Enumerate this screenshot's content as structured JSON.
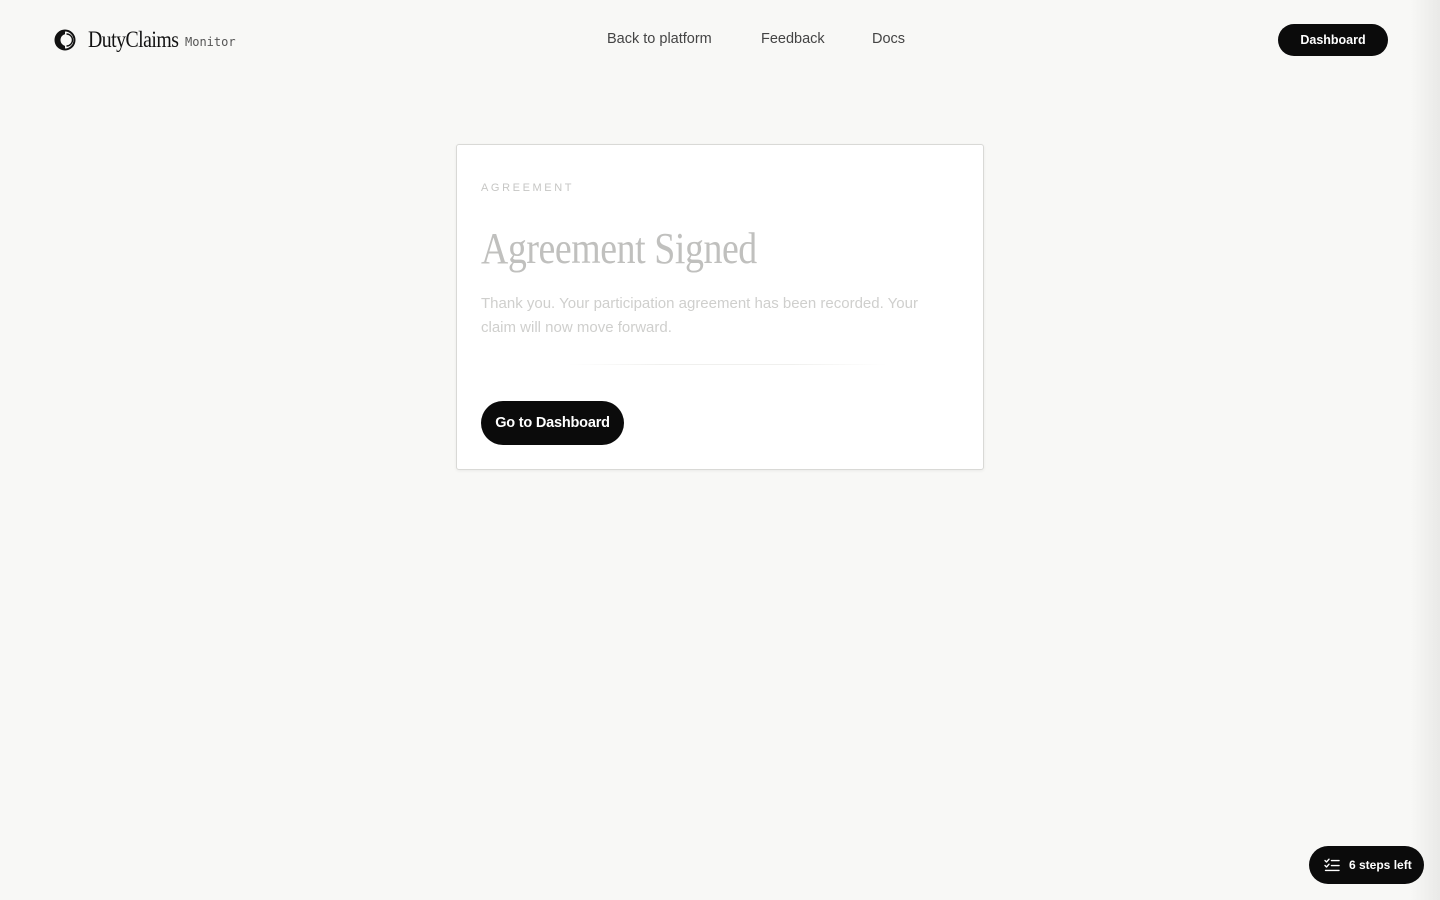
{
  "header": {
    "brand_name": "DutyClaims",
    "brand_sub": "Monitor",
    "nav": {
      "back": "Back to platform",
      "feedback": "Feedback",
      "docs": "Docs"
    },
    "dashboard_label": "Dashboard"
  },
  "card": {
    "eyebrow": "AGREEMENT",
    "title": "Agreement Signed",
    "description": "Thank you. Your participation agreement has been recorded. Your claim will now move forward.",
    "button_label": "Go to Dashboard"
  },
  "steps_pill": {
    "label": "6 steps left",
    "icon": "checklist-icon"
  },
  "colors": {
    "background": "#f8f8f6",
    "primary_button": "#0b0b0b",
    "card_background": "#ffffff"
  }
}
